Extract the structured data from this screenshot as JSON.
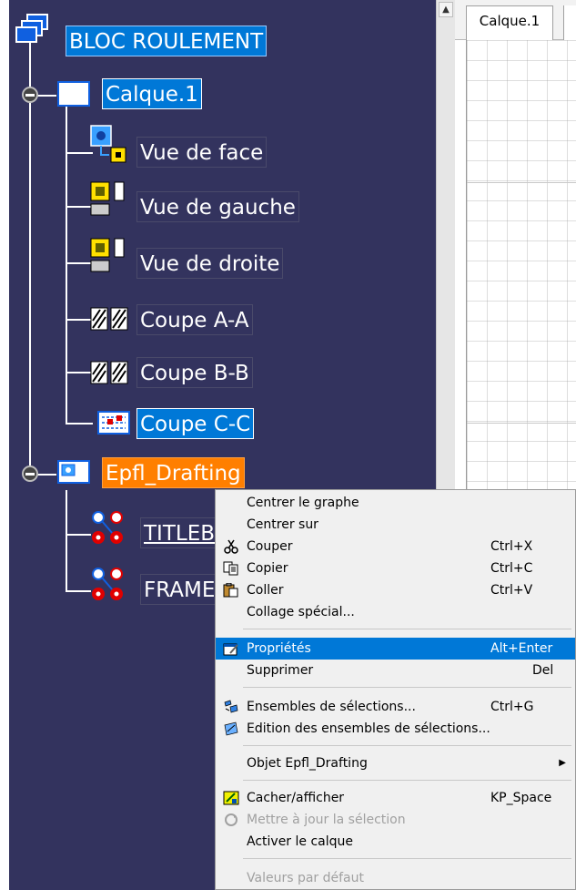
{
  "tree": {
    "root": "BLOC ROULEMENT",
    "sheet_node": "Calque.1",
    "views": [
      "Vue de face",
      "Vue de gauche",
      "Vue de droite",
      "Coupe A-A",
      "Coupe B-B",
      "Coupe C-C"
    ],
    "background_node": "Epfl_Drafting",
    "background_children": [
      "TITLEBLOCK",
      "FRAME"
    ]
  },
  "sheet_tab": {
    "label": "Calque.1"
  },
  "context_menu": {
    "items": [
      {
        "label": "Centrer le graphe",
        "shortcut": ""
      },
      {
        "label": "Centrer sur",
        "shortcut": ""
      },
      {
        "label": "Couper",
        "shortcut": "Ctrl+X",
        "icon": "scissors-icon"
      },
      {
        "label": "Copier",
        "shortcut": "Ctrl+C",
        "icon": "copy-icon"
      },
      {
        "label": "Coller",
        "shortcut": "Ctrl+V",
        "icon": "paste-icon"
      },
      {
        "label": "Collage spécial...",
        "shortcut": ""
      },
      {
        "label": "Propriétés",
        "shortcut": "Alt+Enter",
        "icon": "properties-icon",
        "highlighted": true
      },
      {
        "label": "Supprimer",
        "shortcut": "Del"
      },
      {
        "label": "Ensembles de sélections...",
        "shortcut": "Ctrl+G",
        "icon": "selection-sets-icon"
      },
      {
        "label": "Edition des ensembles de sélections...",
        "shortcut": "",
        "icon": "edit-selection-sets-icon"
      },
      {
        "label": "Objet Epfl_Drafting",
        "shortcut": "",
        "submenu": true
      },
      {
        "label": "Cacher/afficher",
        "shortcut": "KP_Space",
        "icon": "hide-show-icon"
      },
      {
        "label": "Mettre à jour la sélection",
        "shortcut": "",
        "icon": "refresh-icon",
        "disabled": true
      },
      {
        "label": "Activer le calque",
        "shortcut": ""
      },
      {
        "label": "Valeurs par défaut",
        "shortcut": "",
        "disabled": true
      }
    ]
  },
  "colors": {
    "tree_background": "#33335e",
    "selection_blue": "#0078d7",
    "active_orange": "#ff7f00",
    "menu_background": "#f0f0f0"
  }
}
